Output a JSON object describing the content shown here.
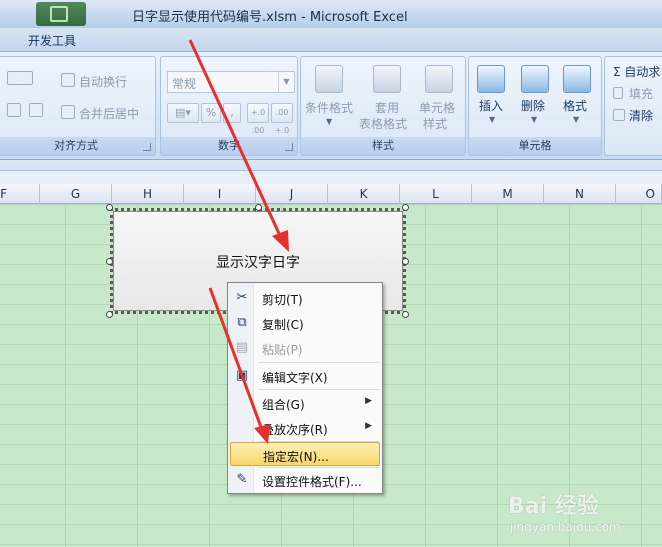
{
  "window": {
    "title": "日字显示使用代码编号.xlsm - Microsoft Excel"
  },
  "ribbon": {
    "active_tab": "开发工具",
    "alignment": {
      "wrap_text": "自动换行",
      "merge_center": "合并后居中",
      "group_title": "对齐方式"
    },
    "number": {
      "format_value": "常规",
      "percent": "%",
      "comma": ",",
      "inc_decimal": "+.0 .00",
      "dec_decimal": ".00 +.0",
      "group_title": "数字"
    },
    "styles": {
      "conditional_format": "条件格式",
      "table_format_line1": "套用",
      "table_format_line2": "表格格式",
      "cell_styles_line1": "单元格",
      "cell_styles_line2": "样式",
      "group_title": "样式"
    },
    "cells": {
      "insert": "插入",
      "delete": "删除",
      "format": "格式",
      "group_title": "单元格"
    },
    "editing": {
      "autosum": "Σ 自动求",
      "fill": "填充",
      "clear": "清除"
    }
  },
  "columns": [
    "F",
    "G",
    "H",
    "I",
    "J",
    "K",
    "L",
    "M",
    "N",
    "O"
  ],
  "shape": {
    "label": "显示汉字日字"
  },
  "context_menu": {
    "items": [
      {
        "label": "剪切(T)",
        "icon": "scissors-icon",
        "disabled": false
      },
      {
        "label": "复制(C)",
        "icon": "copy-icon",
        "disabled": false
      },
      {
        "label": "粘贴(P)",
        "icon": "paste-icon",
        "disabled": true
      },
      {
        "label": "编辑文字(X)",
        "icon": "edit-text-icon",
        "disabled": false
      },
      {
        "label": "组合(G)",
        "icon": "",
        "disabled": false,
        "submenu": true
      },
      {
        "label": "叠放次序(R)",
        "icon": "",
        "disabled": false,
        "submenu": true
      },
      {
        "label": "指定宏(N)...",
        "icon": "",
        "disabled": false,
        "highlighted": true
      },
      {
        "label": "设置控件格式(F)...",
        "icon": "format-control-icon",
        "disabled": false
      }
    ]
  },
  "watermark": {
    "logo": "Bai 经验",
    "url": "jingyan.baidu.com"
  }
}
